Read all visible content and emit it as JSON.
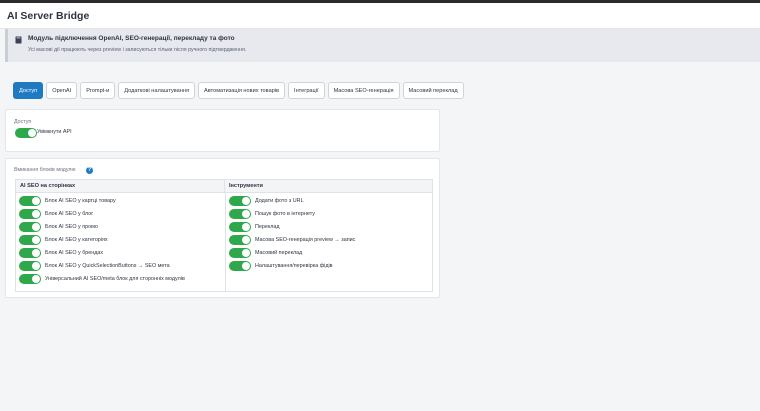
{
  "app": {
    "title": "AI Server Bridge"
  },
  "notice": {
    "title": "Модуль підключення OpenAI, SEO-генерації, перекладу та фото",
    "text": "Усі масові дії працюють через preview і записуються тільки після ручного підтвердження."
  },
  "tabs": [
    {
      "label": "Доступ",
      "active": true
    },
    {
      "label": "OpenAI",
      "active": false
    },
    {
      "label": "Prompt-и",
      "active": false
    },
    {
      "label": "Додаткові налаштування",
      "active": false
    },
    {
      "label": "Автоматизація нових товарів",
      "active": false
    },
    {
      "label": "Інтеграції",
      "active": false
    },
    {
      "label": "Масова SEO-генерація",
      "active": false
    },
    {
      "label": "Масовий переклад",
      "active": false
    }
  ],
  "access": {
    "section_label": "Доступ",
    "api_toggle_label": "Увімкнути API",
    "api_enabled": true
  },
  "blocks": {
    "section_label": "Вмикання блоків модулю",
    "help_symbol": "?",
    "col_left_header": "AI SEO на сторінках",
    "col_right_header": "Інструменти",
    "left_items": [
      {
        "label": "Блок AI SEO у картці товару",
        "enabled": true
      },
      {
        "label": "Блок AI SEO у блог",
        "enabled": true
      },
      {
        "label": "Блок AI SEO у промо",
        "enabled": true
      },
      {
        "label": "Блок AI SEO у категоріях",
        "enabled": true
      },
      {
        "label": "Блок AI SEO у брендах",
        "enabled": true
      },
      {
        "label": "Блок AI SEO у QuickSelectionButtons → SEO мета",
        "enabled": true
      },
      {
        "label": "Універсальний AI SEO/meta блок для сторонніх модулів",
        "enabled": true
      }
    ],
    "right_items": [
      {
        "label": "Додати фото з URL",
        "enabled": true
      },
      {
        "label": "Пошук фото в інтернету",
        "enabled": true
      },
      {
        "label": "Переклад",
        "enabled": true
      },
      {
        "label": "Масова SEO-генерація preview → запис",
        "enabled": true
      },
      {
        "label": "Масовий переклад",
        "enabled": true
      },
      {
        "label": "Налаштування/перевірка фідів",
        "enabled": true
      }
    ]
  },
  "colors": {
    "accent": "#1f7ac1",
    "toggle_on": "#2ea84a"
  }
}
